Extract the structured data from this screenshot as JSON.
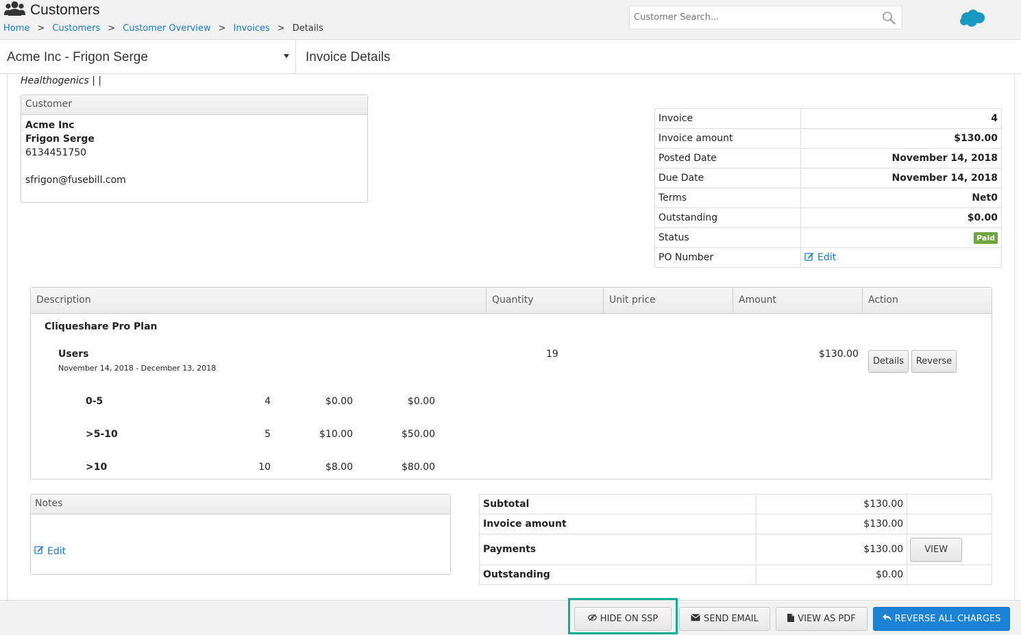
{
  "header": {
    "app_title": "Customers",
    "breadcrumb": [
      {
        "label": "Home"
      },
      {
        "label": "Customers"
      },
      {
        "label": "Customer Overview"
      },
      {
        "label": "Invoices"
      }
    ],
    "breadcrumb_current": "Details",
    "breadcrumb_separator": ">",
    "search_placeholder": "Customer Search..."
  },
  "subheader": {
    "account_name": "Acme Inc - Frigon Serge",
    "page_title": "Invoice Details"
  },
  "company_line": "Healthogenics | |",
  "customer": {
    "heading": "Customer",
    "company": "Acme Inc",
    "contact": "Frigon Serge",
    "phone": "6134451750",
    "email": "sfrigon@fusebill.com"
  },
  "invoice": {
    "rows": [
      {
        "label": "Invoice",
        "value": "4"
      },
      {
        "label": "Invoice amount",
        "value": "$130.00"
      },
      {
        "label": "Posted Date",
        "value": "November 14, 2018"
      },
      {
        "label": "Due Date",
        "value": "November 14, 2018"
      },
      {
        "label": "Terms",
        "value": "Net0"
      },
      {
        "label": "Outstanding",
        "value": "$0.00"
      }
    ],
    "status_label": "Status",
    "status_value": "Paid",
    "po_label": "PO Number",
    "po_edit": "Edit"
  },
  "items": {
    "columns": [
      "Description",
      "Quantity",
      "Unit price",
      "Amount",
      "Action"
    ],
    "plan_name": "Cliqueshare Pro Plan",
    "product": {
      "name": "Users",
      "period": "November 14, 2018 - December 13, 2018",
      "quantity": "19",
      "amount": "$130.00",
      "details_label": "Details",
      "reverse_label": "Reverse"
    },
    "tiers": [
      {
        "range": "0-5",
        "qty": "4",
        "unit": "$0.00",
        "amount": "$0.00"
      },
      {
        "range": ">5-10",
        "qty": "5",
        "unit": "$10.00",
        "amount": "$50.00"
      },
      {
        "range": ">10",
        "qty": "10",
        "unit": "$8.00",
        "amount": "$80.00"
      }
    ]
  },
  "notes": {
    "heading": "Notes",
    "edit": "Edit"
  },
  "totals": {
    "subtotal_label": "Subtotal",
    "subtotal": "$130.00",
    "invoice_amount_label": "Invoice amount",
    "invoice_amount": "$130.00",
    "payments_label": "Payments",
    "payments": "$130.00",
    "view_label": "VIEW",
    "outstanding_label": "Outstanding",
    "outstanding": "$0.00"
  },
  "footer": {
    "hide_ssp": "HIDE ON SSP",
    "send_email": "SEND EMAIL",
    "view_pdf": "VIEW AS PDF",
    "reverse_all": "REVERSE ALL CHARGES"
  },
  "colors": {
    "link": "#1a7ac6",
    "paid_badge": "#6da53a",
    "primary_button": "#1a83d6",
    "highlight": "#16a994"
  },
  "icons": [
    "users-icon",
    "search-icon",
    "salesforce-cloud-icon",
    "caret-down-icon",
    "edit-icon",
    "eye-slash-icon",
    "envelope-icon",
    "file-icon",
    "reply-icon"
  ]
}
